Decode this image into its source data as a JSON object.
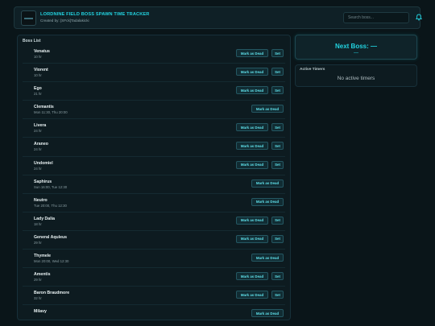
{
  "header": {
    "title": "LORDNINE FIELD BOSS SPAWN TIME TRACKER",
    "subtitle": "Created by: [SFck]Tadalakicki",
    "search_placeholder": "Search boss...",
    "bell_icon": "bell-icon"
  },
  "boss_list": {
    "title": "Boss List",
    "mark_dead_label": "Mark as Dead",
    "set_label": "Set",
    "bosses": [
      {
        "name": "Venatus",
        "info": "10 hr",
        "has_set": true
      },
      {
        "name": "Viorent",
        "info": "10 hr",
        "has_set": true
      },
      {
        "name": "Ego",
        "info": "21 hr",
        "has_set": true
      },
      {
        "name": "Clemantis",
        "info": "Mon 11:30, Thu 20:00",
        "has_set": false
      },
      {
        "name": "Livera",
        "info": "24 hr",
        "has_set": true
      },
      {
        "name": "Araneo",
        "info": "24 hr",
        "has_set": true
      },
      {
        "name": "Undomiel",
        "info": "24 hr",
        "has_set": true
      },
      {
        "name": "Saphirus",
        "info": "Sun 16:00, Tue 12:30",
        "has_set": false
      },
      {
        "name": "Neutro",
        "info": "Tue 20:00, Thu 12:30",
        "has_set": false
      },
      {
        "name": "Lady Dalia",
        "info": "18 hr",
        "has_set": true
      },
      {
        "name": "General Aquleus",
        "info": "29 hr",
        "has_set": true
      },
      {
        "name": "Thymele",
        "info": "Mon 20:00, Wed 12:30",
        "has_set": false
      },
      {
        "name": "Amentis",
        "info": "29 hr",
        "has_set": true
      },
      {
        "name": "Baron Braudmore",
        "info": "32 hr",
        "has_set": true
      },
      {
        "name": "Milavy",
        "info": "",
        "has_set": false
      }
    ]
  },
  "next_boss": {
    "title": "Next Boss: —",
    "subtitle": "—"
  },
  "active_timers": {
    "title": "Active Timers",
    "empty_text": "No active timers"
  },
  "colors": {
    "accent": "#22d3e0",
    "background": "#0a1519",
    "panel": "#0d1b20"
  }
}
